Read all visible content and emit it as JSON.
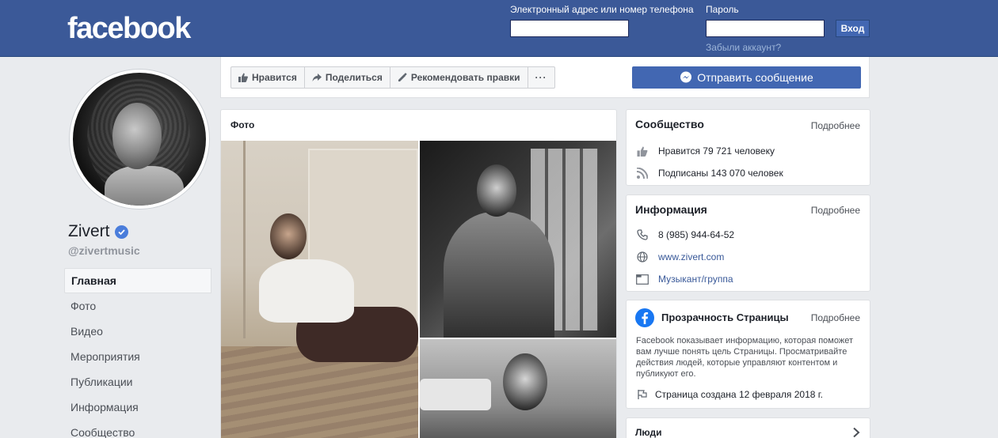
{
  "header": {
    "logo": "facebook",
    "email_label": "Электронный адрес или номер телефона",
    "password_label": "Пароль",
    "email_value": "",
    "password_value": "",
    "login_button": "Вход",
    "forgot_link": "Забыли аккаунт?"
  },
  "profile": {
    "name": "Zivert",
    "handle": "@zivertmusic"
  },
  "nav": {
    "items": [
      {
        "label": "Главная",
        "active": true
      },
      {
        "label": "Фото"
      },
      {
        "label": "Видео"
      },
      {
        "label": "Мероприятия"
      },
      {
        "label": "Публикации"
      },
      {
        "label": "Информация"
      },
      {
        "label": "Сообщество"
      }
    ]
  },
  "actions": {
    "like": "Нравится",
    "share": "Поделиться",
    "suggest_edits": "Рекомендовать правки",
    "more": "···",
    "send_message": "Отправить сообщение"
  },
  "photos": {
    "title": "Фото"
  },
  "community": {
    "title": "Сообщество",
    "more": "Подробнее",
    "likes": "Нравится 79 721 человеку",
    "followers": "Подписаны 143 070 человек"
  },
  "info": {
    "title": "Информация",
    "more": "Подробнее",
    "phone": "8 (985) 944-64-52",
    "website": "www.zivert.com",
    "category": "Музыкант/группа"
  },
  "transparency": {
    "title": "Прозрачность Страницы",
    "more": "Подробнее",
    "text": "Facebook показывает информацию, которая поможет вам лучше понять цель Страницы. Просматривайте действия людей, которые управляют контентом и публикуют его.",
    "created": "Страница создана 12 февраля 2018 г."
  },
  "people": {
    "title": "Люди"
  },
  "colors": {
    "brand": "#3b5998",
    "button": "#4267b2",
    "link": "#385898",
    "verified": "#4a7ddb"
  }
}
